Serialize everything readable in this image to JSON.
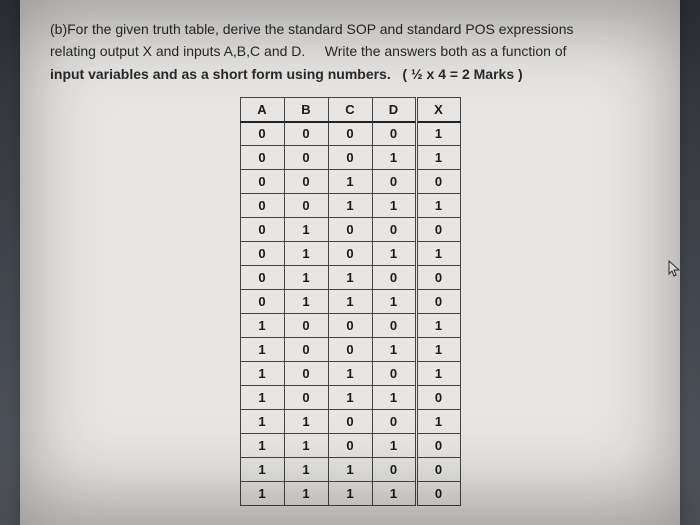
{
  "question": {
    "line1_prefix": "(b)For the given truth table, derive the standard SOP and standard POS expressions",
    "line2_prefix": "relating output X and inputs A,B,C and D.",
    "line2_emph": "Write the answers both as a function of",
    "line3_emph": "input variables and as a short form using numbers.",
    "line3_marks": "( ½ x 4 = 2 Marks )"
  },
  "table": {
    "headers": [
      "A",
      "B",
      "C",
      "D",
      "X"
    ],
    "rows": [
      [
        "0",
        "0",
        "0",
        "0",
        "1"
      ],
      [
        "0",
        "0",
        "0",
        "1",
        "1"
      ],
      [
        "0",
        "0",
        "1",
        "0",
        "0"
      ],
      [
        "0",
        "0",
        "1",
        "1",
        "1"
      ],
      [
        "0",
        "1",
        "0",
        "0",
        "0"
      ],
      [
        "0",
        "1",
        "0",
        "1",
        "1"
      ],
      [
        "0",
        "1",
        "1",
        "0",
        "0"
      ],
      [
        "0",
        "1",
        "1",
        "1",
        "0"
      ],
      [
        "1",
        "0",
        "0",
        "0",
        "1"
      ],
      [
        "1",
        "0",
        "0",
        "1",
        "1"
      ],
      [
        "1",
        "0",
        "1",
        "0",
        "1"
      ],
      [
        "1",
        "0",
        "1",
        "1",
        "0"
      ],
      [
        "1",
        "1",
        "0",
        "0",
        "1"
      ],
      [
        "1",
        "1",
        "0",
        "1",
        "0"
      ],
      [
        "1",
        "1",
        "1",
        "0",
        "0"
      ],
      [
        "1",
        "1",
        "1",
        "1",
        "0"
      ]
    ]
  },
  "chart_data": {
    "type": "table",
    "title": "Truth table for output X with inputs A,B,C,D",
    "columns": [
      "A",
      "B",
      "C",
      "D",
      "X"
    ],
    "data": [
      {
        "A": 0,
        "B": 0,
        "C": 0,
        "D": 0,
        "X": 1
      },
      {
        "A": 0,
        "B": 0,
        "C": 0,
        "D": 1,
        "X": 1
      },
      {
        "A": 0,
        "B": 0,
        "C": 1,
        "D": 0,
        "X": 0
      },
      {
        "A": 0,
        "B": 0,
        "C": 1,
        "D": 1,
        "X": 1
      },
      {
        "A": 0,
        "B": 1,
        "C": 0,
        "D": 0,
        "X": 0
      },
      {
        "A": 0,
        "B": 1,
        "C": 0,
        "D": 1,
        "X": 1
      },
      {
        "A": 0,
        "B": 1,
        "C": 1,
        "D": 0,
        "X": 0
      },
      {
        "A": 0,
        "B": 1,
        "C": 1,
        "D": 1,
        "X": 0
      },
      {
        "A": 1,
        "B": 0,
        "C": 0,
        "D": 0,
        "X": 1
      },
      {
        "A": 1,
        "B": 0,
        "C": 0,
        "D": 1,
        "X": 1
      },
      {
        "A": 1,
        "B": 0,
        "C": 1,
        "D": 0,
        "X": 1
      },
      {
        "A": 1,
        "B": 0,
        "C": 1,
        "D": 1,
        "X": 0
      },
      {
        "A": 1,
        "B": 1,
        "C": 0,
        "D": 0,
        "X": 1
      },
      {
        "A": 1,
        "B": 1,
        "C": 0,
        "D": 1,
        "X": 0
      },
      {
        "A": 1,
        "B": 1,
        "C": 1,
        "D": 0,
        "X": 0
      },
      {
        "A": 1,
        "B": 1,
        "C": 1,
        "D": 1,
        "X": 0
      }
    ]
  },
  "cursor_glyph": "↖"
}
